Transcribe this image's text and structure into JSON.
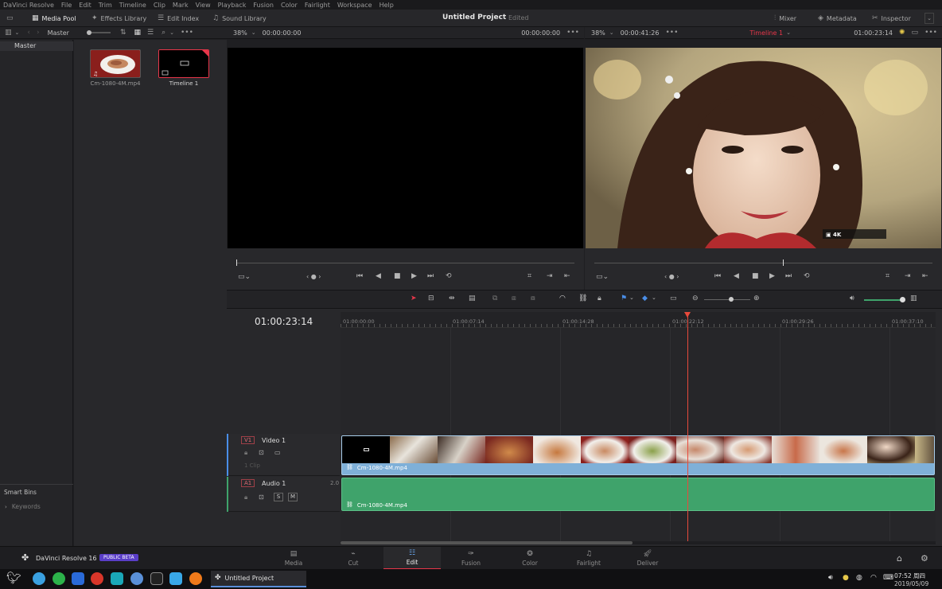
{
  "menu": [
    "DaVinci Resolve",
    "File",
    "Edit",
    "Trim",
    "Timeline",
    "Clip",
    "Mark",
    "View",
    "Playback",
    "Fusion",
    "Color",
    "Fairlight",
    "Workspace",
    "Help"
  ],
  "toolbar": {
    "media_pool": "Media Pool",
    "effects_library": "Effects Library",
    "edit_index": "Edit Index",
    "sound_library": "Sound Library",
    "project_title": "Untitled Project",
    "project_status": "Edited",
    "mixer": "Mixer",
    "metadata": "Metadata",
    "inspector": "Inspector"
  },
  "media_pool": {
    "bin": "Master",
    "sidebar_root": "Master",
    "smart_bins": "Smart Bins",
    "keywords": "Keywords",
    "clips": [
      {
        "label": "Cm-1080-4M.mp4"
      },
      {
        "label": "Timeline 1"
      }
    ]
  },
  "source_viewer": {
    "zoom": "38%",
    "timecode_left": "00:00:00:00",
    "timecode_right": "00:00:00:00"
  },
  "timeline_viewer": {
    "zoom": "38%",
    "duration": "00:00:41:26",
    "timeline_name": "Timeline 1",
    "timecode": "01:00:23:14"
  },
  "timeline": {
    "current_timecode": "01:00:23:14",
    "ruler": [
      "01:00:00:00",
      "01:00:07:14",
      "01:00:14:28",
      "01:00:22:12",
      "01:00:29:26",
      "01:00:37:10"
    ],
    "playhead_fraction": 0.583,
    "video_track": {
      "id": "V1",
      "name": "Video 1",
      "clip_count": "1 Clip",
      "clip_name": "Cm-1080-4M.mp4"
    },
    "audio_track": {
      "id": "A1",
      "name": "Audio 1",
      "channel": "2.0",
      "solo": "S",
      "mute": "M",
      "clip_name": "Cm-1080-4M.mp4"
    }
  },
  "bottom": {
    "app_name": "DaVinci Resolve 16",
    "beta_badge": "PUBLIC BETA",
    "pages": [
      "Media",
      "Cut",
      "Edit",
      "Fusion",
      "Color",
      "Fairlight",
      "Deliver"
    ],
    "active_page": "Edit"
  },
  "taskbar": {
    "window_title": "Untitled Project",
    "time": "07:52 周四",
    "date": "2019/05/09"
  },
  "colors": {
    "accent_red": "#e8364a",
    "video_clip": "#7fb0d8",
    "audio_clip": "#3fa36b",
    "playhead": "#e84a3c"
  }
}
